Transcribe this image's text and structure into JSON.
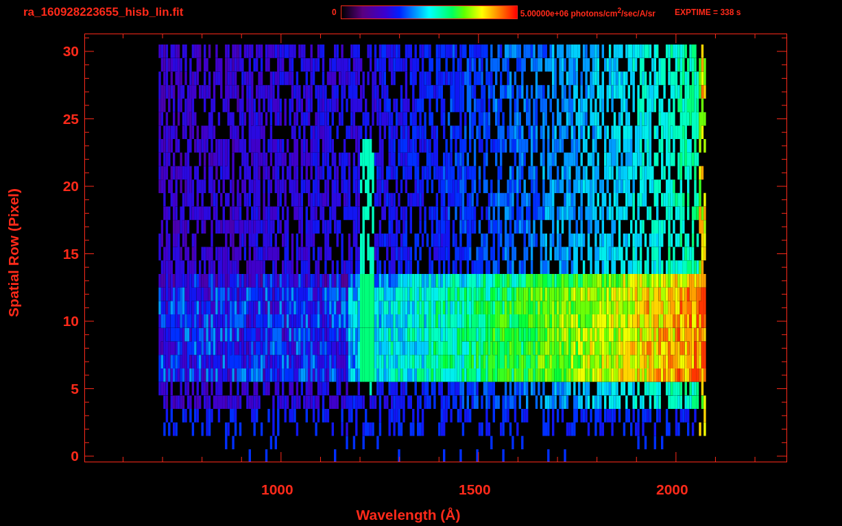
{
  "title": "ra_160928223655_hisb_lin.fit",
  "colorbar": {
    "min_label": "0",
    "max_label": "5.00000e+06 photons/cm$^{2}$/sec/A/sr"
  },
  "exposure": "EXPTIME = 338 s",
  "plot": {
    "xlabel": "Wavelength (Å)",
    "ylabel": "Spatial Row (Pixel)",
    "xticks": [
      "1000",
      "1500",
      "2000"
    ],
    "yticks": [
      "30",
      "25",
      "20",
      "15",
      "10",
      "5",
      "0"
    ]
  }
}
